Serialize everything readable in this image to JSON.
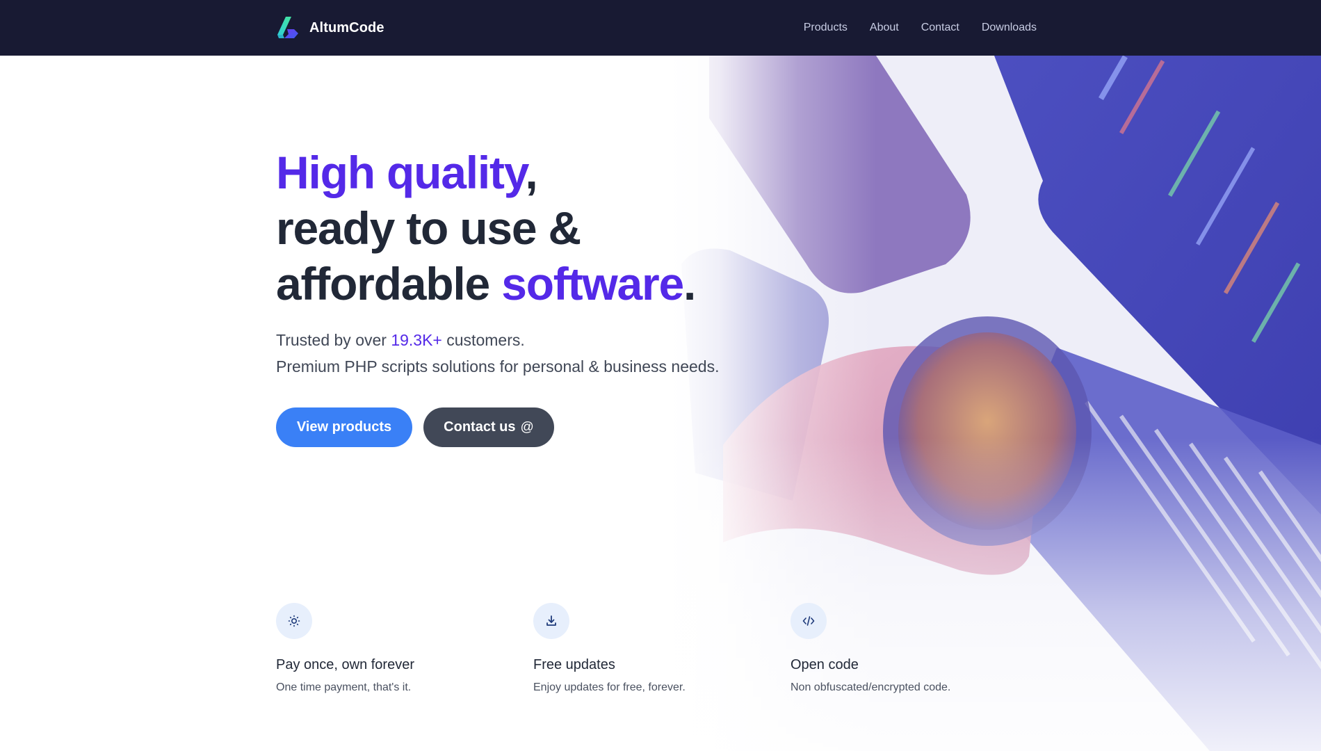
{
  "navbar": {
    "brand": "AltumCode",
    "links": [
      "Products",
      "About",
      "Contact",
      "Downloads"
    ]
  },
  "hero": {
    "headline": {
      "line1_accent": "High quality",
      "line1_tail": ",",
      "line2": "ready to use &",
      "line3_lead": "affordable ",
      "line3_accent": "software",
      "line3_tail": "."
    },
    "subtitle": {
      "line1_lead": "Trusted by over ",
      "customers_count": "19.3K+",
      "line1_tail": " customers.",
      "line2": "Premium PHP scripts solutions for personal & business needs."
    },
    "buttons": {
      "primary": "View products",
      "secondary": "Contact us",
      "secondary_icon": "@"
    }
  },
  "features": [
    {
      "icon": "sun-icon",
      "title": "Pay once, own forever",
      "description": "One time payment, that's it."
    },
    {
      "icon": "download-icon",
      "title": "Free updates",
      "description": "Enjoy updates for free, forever."
    },
    {
      "icon": "code-icon",
      "title": "Open code",
      "description": "Non obfuscated/encrypted code."
    }
  ],
  "colors": {
    "navbar_bg": "#181a33",
    "accent": "#5429e8",
    "primary_button": "#3a80f6",
    "secondary_button": "#414857",
    "icon_bg": "#e7effc"
  }
}
